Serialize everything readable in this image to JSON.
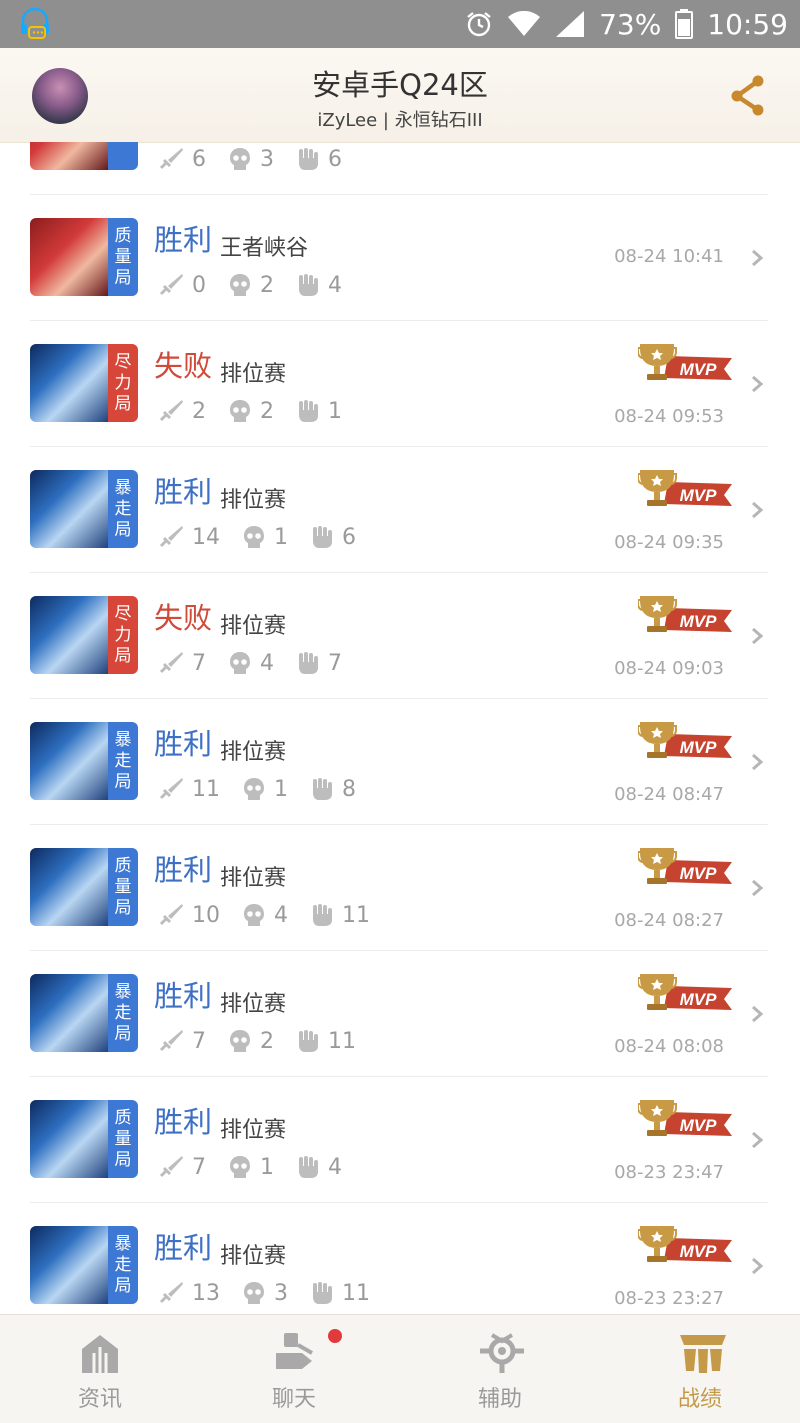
{
  "status_bar": {
    "battery": "73%",
    "time": "10:59"
  },
  "header": {
    "title": "安卓手Q24区",
    "subtitle": "iZyLee | 永恒钻石III"
  },
  "matches": [
    {
      "hero": "red",
      "tag": [
        "局"
      ],
      "tag_color": "blue",
      "result": "",
      "mode": "",
      "kills": "6",
      "deaths": "3",
      "assists": "6",
      "time": "",
      "mvp": false
    },
    {
      "hero": "red",
      "tag": [
        "质",
        "量",
        "局"
      ],
      "tag_color": "blue",
      "result": "胜利",
      "result_type": "win",
      "mode": "王者峡谷",
      "kills": "0",
      "deaths": "2",
      "assists": "4",
      "time": "08-24 10:41",
      "mvp": false
    },
    {
      "hero": "blue",
      "tag": [
        "尽",
        "力",
        "局"
      ],
      "tag_color": "red",
      "result": "失败",
      "result_type": "lose",
      "mode": "排位赛",
      "kills": "2",
      "deaths": "2",
      "assists": "1",
      "time": "08-24 09:53",
      "mvp": true
    },
    {
      "hero": "blue",
      "tag": [
        "暴",
        "走",
        "局"
      ],
      "tag_color": "blue",
      "result": "胜利",
      "result_type": "win",
      "mode": "排位赛",
      "kills": "14",
      "deaths": "1",
      "assists": "6",
      "time": "08-24 09:35",
      "mvp": true
    },
    {
      "hero": "blue",
      "tag": [
        "尽",
        "力",
        "局"
      ],
      "tag_color": "red",
      "result": "失败",
      "result_type": "lose",
      "mode": "排位赛",
      "kills": "7",
      "deaths": "4",
      "assists": "7",
      "time": "08-24 09:03",
      "mvp": true
    },
    {
      "hero": "blue",
      "tag": [
        "暴",
        "走",
        "局"
      ],
      "tag_color": "blue",
      "result": "胜利",
      "result_type": "win",
      "mode": "排位赛",
      "kills": "11",
      "deaths": "1",
      "assists": "8",
      "time": "08-24 08:47",
      "mvp": true
    },
    {
      "hero": "blue",
      "tag": [
        "质",
        "量",
        "局"
      ],
      "tag_color": "blue",
      "result": "胜利",
      "result_type": "win",
      "mode": "排位赛",
      "kills": "10",
      "deaths": "4",
      "assists": "11",
      "time": "08-24 08:27",
      "mvp": true
    },
    {
      "hero": "blue",
      "tag": [
        "暴",
        "走",
        "局"
      ],
      "tag_color": "blue",
      "result": "胜利",
      "result_type": "win",
      "mode": "排位赛",
      "kills": "7",
      "deaths": "2",
      "assists": "11",
      "time": "08-24 08:08",
      "mvp": true
    },
    {
      "hero": "blue",
      "tag": [
        "质",
        "量",
        "局"
      ],
      "tag_color": "blue",
      "result": "胜利",
      "result_type": "win",
      "mode": "排位赛",
      "kills": "7",
      "deaths": "1",
      "assists": "4",
      "time": "08-23 23:47",
      "mvp": true
    },
    {
      "hero": "blue",
      "tag": [
        "暴",
        "走",
        "局"
      ],
      "tag_color": "blue",
      "result": "胜利",
      "result_type": "win",
      "mode": "排位赛",
      "kills": "13",
      "deaths": "3",
      "assists": "11",
      "time": "08-23 23:27",
      "mvp": true
    }
  ],
  "mvp_label": "MVP",
  "nav": [
    {
      "label": "资讯",
      "icon": "news-icon",
      "active": false
    },
    {
      "label": "聊天",
      "icon": "chat-icon",
      "active": false,
      "badge": true
    },
    {
      "label": "辅助",
      "icon": "assist-icon",
      "active": false
    },
    {
      "label": "战绩",
      "icon": "record-icon",
      "active": true
    }
  ],
  "colors": {
    "win": "#3d6fc4",
    "lose": "#cf4a39",
    "accent": "#c49a48"
  }
}
